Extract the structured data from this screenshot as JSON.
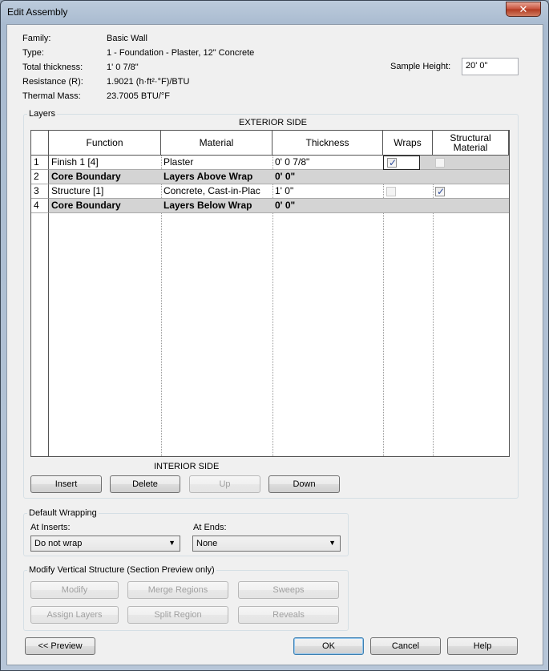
{
  "window": {
    "title": "Edit Assembly",
    "close_glyph": "✕"
  },
  "properties": {
    "family_label": "Family:",
    "family_value": "Basic Wall",
    "type_label": "Type:",
    "type_value": "1 - Foundation - Plaster, 12\" Concrete",
    "thickness_label": "Total thickness:",
    "thickness_value": "1'  0 7/8\"",
    "resistance_label": "Resistance (R):",
    "resistance_value": "1.9021 (h·ft²·°F)/BTU",
    "thermal_label": "Thermal Mass:",
    "thermal_value": "23.7005 BTU/°F",
    "sample_height_label": "Sample Height:",
    "sample_height_value": "20'  0\""
  },
  "layers": {
    "group_title": "Layers",
    "exterior_label": "EXTERIOR SIDE",
    "interior_label": "INTERIOR SIDE",
    "columns": {
      "function": "Function",
      "material": "Material",
      "thickness": "Thickness",
      "wraps": "Wraps",
      "structural_line1": "Structural",
      "structural_line2": "Material"
    },
    "rows": [
      {
        "num": "1",
        "function": "Finish 1 [4]",
        "material": "Plaster",
        "thickness": "0'  0 7/8\"",
        "wraps": true,
        "structural": false
      },
      {
        "num": "2",
        "function": "Core Boundary",
        "material": "Layers Above Wrap",
        "thickness": "0'  0\""
      },
      {
        "num": "3",
        "function": "Structure [1]",
        "material": "Concrete, Cast-in-Plac",
        "thickness": "1'  0\"",
        "wraps": false,
        "structural": true
      },
      {
        "num": "4",
        "function": "Core Boundary",
        "material": "Layers Below Wrap",
        "thickness": "0'  0\""
      }
    ],
    "buttons": {
      "insert": "Insert",
      "delete": "Delete",
      "up": "Up",
      "down": "Down"
    }
  },
  "wrapping": {
    "group_title": "Default Wrapping",
    "at_inserts_label": "At Inserts:",
    "at_inserts_value": "Do not wrap",
    "at_ends_label": "At Ends:",
    "at_ends_value": "None"
  },
  "modify": {
    "group_title": "Modify Vertical Structure (Section Preview only)",
    "modify": "Modify",
    "merge": "Merge Regions",
    "sweeps": "Sweeps",
    "assign": "Assign Layers",
    "split": "Split Region",
    "reveals": "Reveals"
  },
  "footer": {
    "preview": "<< Preview",
    "ok": "OK",
    "cancel": "Cancel",
    "help": "Help"
  }
}
